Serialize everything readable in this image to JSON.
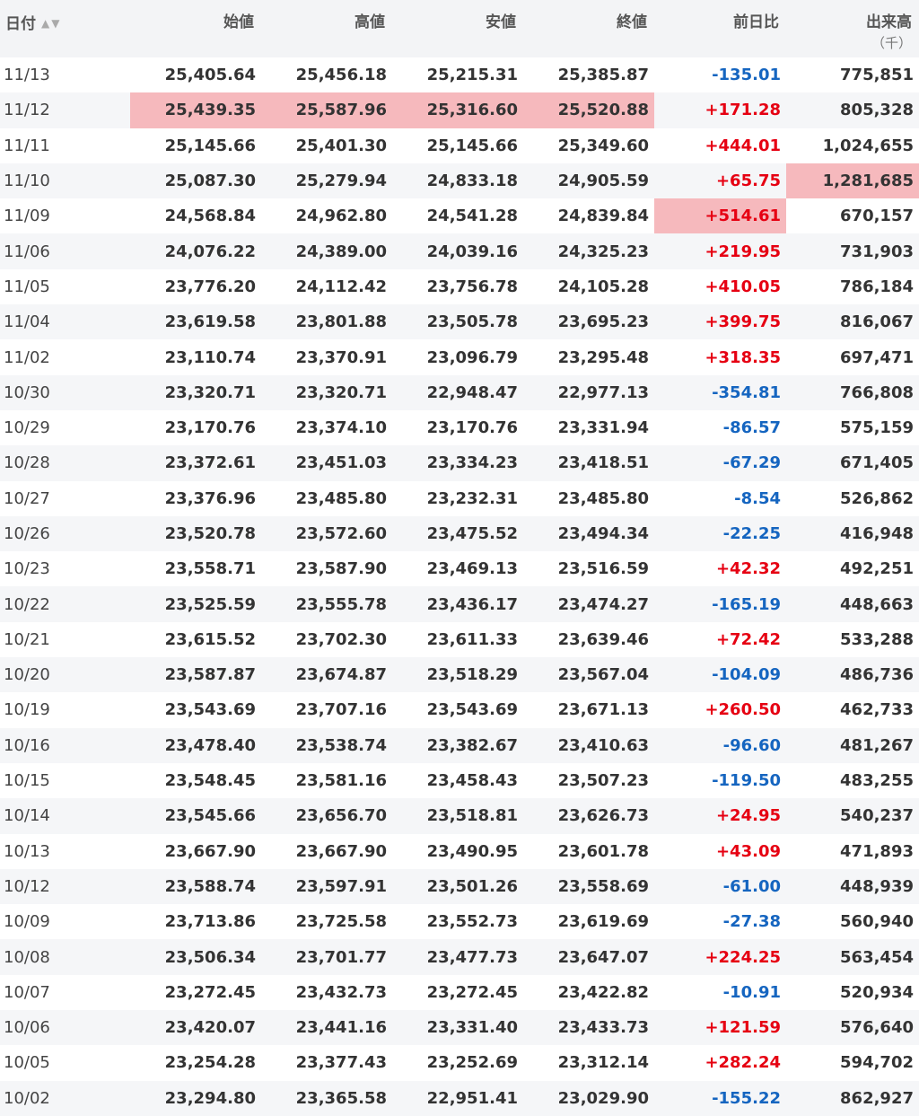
{
  "table": {
    "headers": {
      "date": "日付",
      "open": "始値",
      "high": "高値",
      "low": "安値",
      "close": "終値",
      "change": "前日比",
      "volume": "出来高",
      "volume_unit": "（千）"
    },
    "highlight_color": "#f6b9bd",
    "up_color": "#e60012",
    "down_color": "#1565c0",
    "rows": [
      {
        "date": "11/13",
        "open": "25,405.64",
        "high": "25,456.18",
        "low": "25,215.31",
        "close": "25,385.87",
        "change": "-135.01",
        "volume": "775,851",
        "dir": "down",
        "hl": []
      },
      {
        "date": "11/12",
        "open": "25,439.35",
        "high": "25,587.96",
        "low": "25,316.60",
        "close": "25,520.88",
        "change": "+171.28",
        "volume": "805,328",
        "dir": "up",
        "hl": [
          "open",
          "high",
          "low",
          "close"
        ]
      },
      {
        "date": "11/11",
        "open": "25,145.66",
        "high": "25,401.30",
        "low": "25,145.66",
        "close": "25,349.60",
        "change": "+444.01",
        "volume": "1,024,655",
        "dir": "up",
        "hl": []
      },
      {
        "date": "11/10",
        "open": "25,087.30",
        "high": "25,279.94",
        "low": "24,833.18",
        "close": "24,905.59",
        "change": "+65.75",
        "volume": "1,281,685",
        "dir": "up",
        "hl": [
          "volume"
        ]
      },
      {
        "date": "11/09",
        "open": "24,568.84",
        "high": "24,962.80",
        "low": "24,541.28",
        "close": "24,839.84",
        "change": "+514.61",
        "volume": "670,157",
        "dir": "up",
        "hl": [
          "change"
        ]
      },
      {
        "date": "11/06",
        "open": "24,076.22",
        "high": "24,389.00",
        "low": "24,039.16",
        "close": "24,325.23",
        "change": "+219.95",
        "volume": "731,903",
        "dir": "up",
        "hl": []
      },
      {
        "date": "11/05",
        "open": "23,776.20",
        "high": "24,112.42",
        "low": "23,756.78",
        "close": "24,105.28",
        "change": "+410.05",
        "volume": "786,184",
        "dir": "up",
        "hl": []
      },
      {
        "date": "11/04",
        "open": "23,619.58",
        "high": "23,801.88",
        "low": "23,505.78",
        "close": "23,695.23",
        "change": "+399.75",
        "volume": "816,067",
        "dir": "up",
        "hl": []
      },
      {
        "date": "11/02",
        "open": "23,110.74",
        "high": "23,370.91",
        "low": "23,096.79",
        "close": "23,295.48",
        "change": "+318.35",
        "volume": "697,471",
        "dir": "up",
        "hl": []
      },
      {
        "date": "10/30",
        "open": "23,320.71",
        "high": "23,320.71",
        "low": "22,948.47",
        "close": "22,977.13",
        "change": "-354.81",
        "volume": "766,808",
        "dir": "down",
        "hl": []
      },
      {
        "date": "10/29",
        "open": "23,170.76",
        "high": "23,374.10",
        "low": "23,170.76",
        "close": "23,331.94",
        "change": "-86.57",
        "volume": "575,159",
        "dir": "down",
        "hl": []
      },
      {
        "date": "10/28",
        "open": "23,372.61",
        "high": "23,451.03",
        "low": "23,334.23",
        "close": "23,418.51",
        "change": "-67.29",
        "volume": "671,405",
        "dir": "down",
        "hl": []
      },
      {
        "date": "10/27",
        "open": "23,376.96",
        "high": "23,485.80",
        "low": "23,232.31",
        "close": "23,485.80",
        "change": "-8.54",
        "volume": "526,862",
        "dir": "down",
        "hl": []
      },
      {
        "date": "10/26",
        "open": "23,520.78",
        "high": "23,572.60",
        "low": "23,475.52",
        "close": "23,494.34",
        "change": "-22.25",
        "volume": "416,948",
        "dir": "down",
        "hl": []
      },
      {
        "date": "10/23",
        "open": "23,558.71",
        "high": "23,587.90",
        "low": "23,469.13",
        "close": "23,516.59",
        "change": "+42.32",
        "volume": "492,251",
        "dir": "up",
        "hl": []
      },
      {
        "date": "10/22",
        "open": "23,525.59",
        "high": "23,555.78",
        "low": "23,436.17",
        "close": "23,474.27",
        "change": "-165.19",
        "volume": "448,663",
        "dir": "down",
        "hl": []
      },
      {
        "date": "10/21",
        "open": "23,615.52",
        "high": "23,702.30",
        "low": "23,611.33",
        "close": "23,639.46",
        "change": "+72.42",
        "volume": "533,288",
        "dir": "up",
        "hl": []
      },
      {
        "date": "10/20",
        "open": "23,587.87",
        "high": "23,674.87",
        "low": "23,518.29",
        "close": "23,567.04",
        "change": "-104.09",
        "volume": "486,736",
        "dir": "down",
        "hl": []
      },
      {
        "date": "10/19",
        "open": "23,543.69",
        "high": "23,707.16",
        "low": "23,543.69",
        "close": "23,671.13",
        "change": "+260.50",
        "volume": "462,733",
        "dir": "up",
        "hl": []
      },
      {
        "date": "10/16",
        "open": "23,478.40",
        "high": "23,538.74",
        "low": "23,382.67",
        "close": "23,410.63",
        "change": "-96.60",
        "volume": "481,267",
        "dir": "down",
        "hl": []
      },
      {
        "date": "10/15",
        "open": "23,548.45",
        "high": "23,581.16",
        "low": "23,458.43",
        "close": "23,507.23",
        "change": "-119.50",
        "volume": "483,255",
        "dir": "down",
        "hl": []
      },
      {
        "date": "10/14",
        "open": "23,545.66",
        "high": "23,656.70",
        "low": "23,518.81",
        "close": "23,626.73",
        "change": "+24.95",
        "volume": "540,237",
        "dir": "up",
        "hl": []
      },
      {
        "date": "10/13",
        "open": "23,667.90",
        "high": "23,667.90",
        "low": "23,490.95",
        "close": "23,601.78",
        "change": "+43.09",
        "volume": "471,893",
        "dir": "up",
        "hl": []
      },
      {
        "date": "10/12",
        "open": "23,588.74",
        "high": "23,597.91",
        "low": "23,501.26",
        "close": "23,558.69",
        "change": "-61.00",
        "volume": "448,939",
        "dir": "down",
        "hl": []
      },
      {
        "date": "10/09",
        "open": "23,713.86",
        "high": "23,725.58",
        "low": "23,552.73",
        "close": "23,619.69",
        "change": "-27.38",
        "volume": "560,940",
        "dir": "down",
        "hl": []
      },
      {
        "date": "10/08",
        "open": "23,506.34",
        "high": "23,701.77",
        "low": "23,477.73",
        "close": "23,647.07",
        "change": "+224.25",
        "volume": "563,454",
        "dir": "up",
        "hl": []
      },
      {
        "date": "10/07",
        "open": "23,272.45",
        "high": "23,432.73",
        "low": "23,272.45",
        "close": "23,422.82",
        "change": "-10.91",
        "volume": "520,934",
        "dir": "down",
        "hl": []
      },
      {
        "date": "10/06",
        "open": "23,420.07",
        "high": "23,441.16",
        "low": "23,331.40",
        "close": "23,433.73",
        "change": "+121.59",
        "volume": "576,640",
        "dir": "up",
        "hl": []
      },
      {
        "date": "10/05",
        "open": "23,254.28",
        "high": "23,377.43",
        "low": "23,252.69",
        "close": "23,312.14",
        "change": "+282.24",
        "volume": "594,702",
        "dir": "up",
        "hl": []
      },
      {
        "date": "10/02",
        "open": "23,294.80",
        "high": "23,365.58",
        "low": "22,951.41",
        "close": "23,029.90",
        "change": "-155.22",
        "volume": "862,927",
        "dir": "down",
        "hl": []
      }
    ]
  }
}
